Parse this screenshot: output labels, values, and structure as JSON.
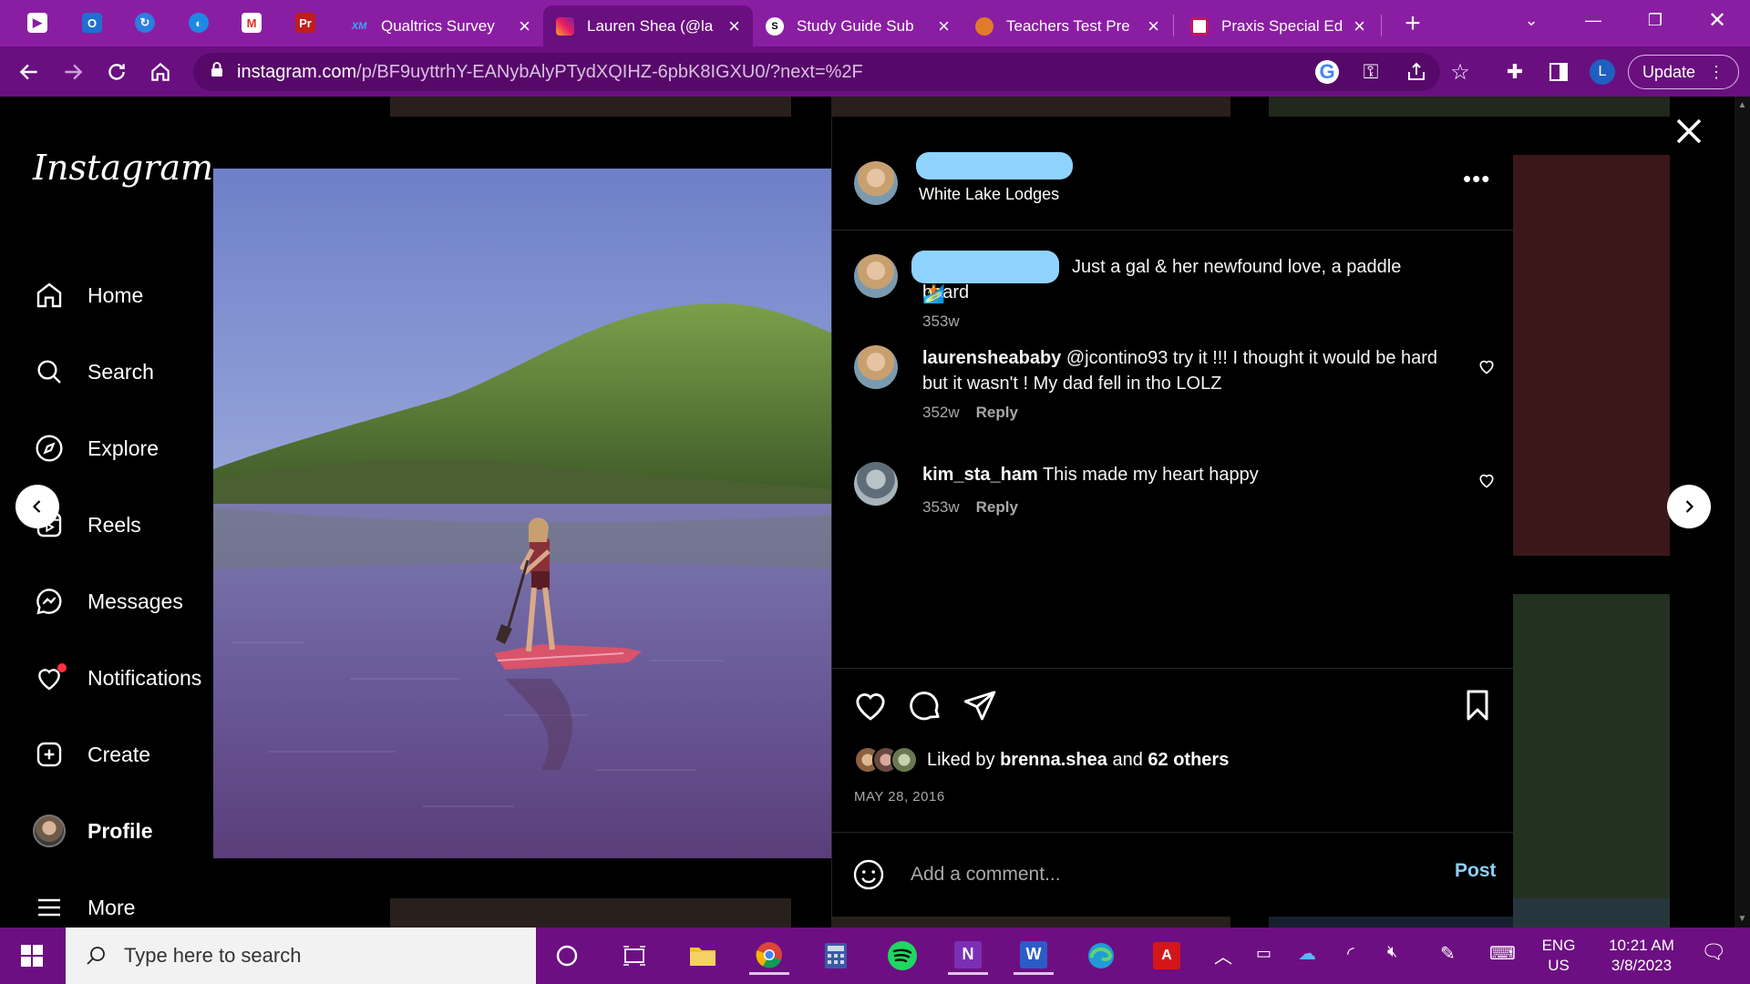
{
  "browser": {
    "pinned_tabs": [
      {
        "icon": "purple-app-icon"
      },
      {
        "icon": "outlook-icon"
      },
      {
        "icon": "edge-sync-icon"
      },
      {
        "icon": "copilot-icon"
      },
      {
        "icon": "gmail-icon"
      },
      {
        "icon": "premiere-icon"
      }
    ],
    "tabs": [
      {
        "label": "Qualtrics Survey",
        "icon": "qualtrics-icon",
        "favtext": "XM",
        "active": false
      },
      {
        "label": "Lauren Shea (@la",
        "icon": "instagram-icon",
        "favtext": "",
        "active": true
      },
      {
        "label": "Study Guide Sub",
        "icon": "study-icon",
        "favtext": "S",
        "active": false
      },
      {
        "label": "Teachers Test Pre",
        "icon": "teachers-icon",
        "favtext": "",
        "active": false
      },
      {
        "label": "Praxis Special Ed",
        "icon": "praxis-icon",
        "favtext": "",
        "active": false
      }
    ],
    "url_host": "instagram.com",
    "url_path": "/p/BF9uyttrhY-EANybAlyPTydXQIHZ-6pbK8IGXU0/?next=%2F",
    "profile_initial": "L",
    "update_label": "Update"
  },
  "sidebar": {
    "logo": "Instagram",
    "items": [
      {
        "label": "Home",
        "icon": "home-icon",
        "bold": false
      },
      {
        "label": "Search",
        "icon": "search-icon",
        "bold": false
      },
      {
        "label": "Explore",
        "icon": "explore-icon",
        "bold": false
      },
      {
        "label": "Reels",
        "icon": "reels-icon",
        "bold": false
      },
      {
        "label": "Messages",
        "icon": "messages-icon",
        "bold": false
      },
      {
        "label": "Notifications",
        "icon": "heart-icon",
        "bold": false
      },
      {
        "label": "Create",
        "icon": "plus-square-icon",
        "bold": false
      },
      {
        "label": "Profile",
        "icon": "avatar",
        "bold": true
      },
      {
        "label": "More",
        "icon": "menu-icon",
        "bold": false
      }
    ]
  },
  "post": {
    "location": "White Lake Lodges",
    "caption": "Just a gal & her newfound love, a paddle board",
    "caption_emoji": "🏄",
    "caption_time": "353w",
    "comments": [
      {
        "user": "laurensheababy",
        "text": "@jcontino93 try it !!! I thought it would be hard but it wasn't ! My dad fell in tho LOLZ",
        "time": "352w",
        "reply": "Reply"
      },
      {
        "user": "kim_sta_ham",
        "text": "This made my heart happy",
        "time": "353w",
        "reply": "Reply"
      }
    ],
    "liked_by_prefix": "Liked by",
    "liked_by_user": "brenna.shea",
    "liked_by_and": "and",
    "liked_by_others": "62 others",
    "date": "MAY 28, 2016",
    "comment_placeholder": "Add a comment...",
    "post_label": "Post"
  },
  "taskbar": {
    "search_placeholder": "Type here to search",
    "apps": [
      "cortana-icon",
      "task-view-icon",
      "file-explorer-icon",
      "chrome-icon",
      "calculator-icon",
      "spotify-icon",
      "onenote-icon",
      "word-icon",
      "edge-icon",
      "acrobat-icon"
    ],
    "lang_top": "ENG",
    "lang_bottom": "US",
    "time": "10:21 AM",
    "date": "3/8/2023"
  },
  "colors": {
    "chrome_frame": "#8a1ea3",
    "taskbar": "#6d0f82",
    "instagram_link_blue": "#8ad1ff",
    "redaction": "#8fd3ff"
  }
}
